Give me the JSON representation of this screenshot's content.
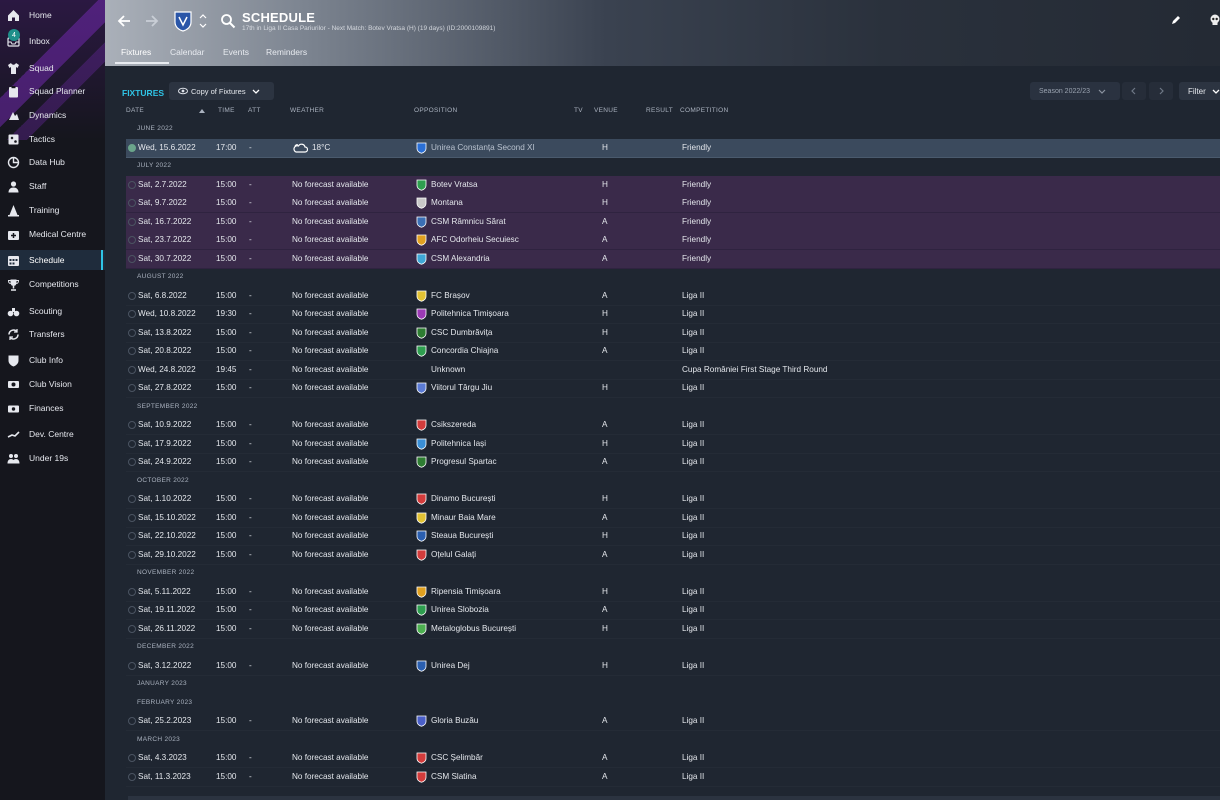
{
  "sidebar": {
    "items": [
      {
        "label": "Home",
        "icon": "home-icon"
      },
      {
        "label": "Inbox",
        "icon": "inbox-icon",
        "badge": "4"
      },
      {
        "label": "Squad",
        "icon": "shirt-icon"
      },
      {
        "label": "Squad Planner",
        "icon": "clipboard-icon"
      },
      {
        "label": "Dynamics",
        "icon": "dynamics-icon"
      },
      {
        "label": "Tactics",
        "icon": "tactics-board-icon"
      },
      {
        "label": "Data Hub",
        "icon": "data-hub-icon"
      },
      {
        "label": "Staff",
        "icon": "staff-icon"
      },
      {
        "label": "Training",
        "icon": "training-cone-icon"
      },
      {
        "label": "Medical Centre",
        "icon": "medical-icon"
      },
      {
        "label": "Schedule",
        "icon": "calendar-icon",
        "active": true
      },
      {
        "label": "Competitions",
        "icon": "trophy-icon"
      },
      {
        "label": "Scouting",
        "icon": "binoculars-icon"
      },
      {
        "label": "Transfers",
        "icon": "transfers-icon"
      },
      {
        "label": "Club Info",
        "icon": "shield-icon"
      },
      {
        "label": "Club Vision",
        "icon": "eye-icon"
      },
      {
        "label": "Finances",
        "icon": "finances-icon"
      },
      {
        "label": "Dev. Centre",
        "icon": "dev-centre-icon"
      },
      {
        "label": "Under 19s",
        "icon": "youth-team-icon"
      }
    ]
  },
  "header": {
    "title": "SCHEDULE",
    "subtitle": "17th in Liga II Casa Pariurilor - Next Match: Botev Vratsa (H) (19 days) (ID:2000109891)",
    "tabs": [
      "Fixtures",
      "Calendar",
      "Events",
      "Reminders"
    ]
  },
  "toolbar": {
    "heading": "FIXTURES",
    "view_label": "Copy of Fixtures",
    "season_label": "Season 2022/23",
    "filter_label": "Filter"
  },
  "columns": {
    "date": "DATE",
    "time": "TIME",
    "att": "ATT",
    "weather": "WEATHER",
    "opposition": "OPPOSITION",
    "tv": "TV",
    "venue": "VENUE",
    "result": "RESULT",
    "competition": "COMPETITION"
  },
  "colors": {
    "accent": "#2fc4e6",
    "friendly_row": "#3a2a4a",
    "selected_row": "#3b4a5d"
  },
  "schedule": [
    {
      "type": "month",
      "label": "JUNE 2022"
    },
    {
      "type": "fixture",
      "date": "Wed, 15.6.2022",
      "time": "17:00",
      "att": "-",
      "weather": "18°C",
      "weather_icon": "cloudy-icon",
      "opposition": "Unirea Constanța Second XI",
      "venue": "H",
      "competition": "Friendly",
      "selected": true,
      "friendly": false
    },
    {
      "type": "month",
      "label": "JULY 2022"
    },
    {
      "type": "fixture",
      "date": "Sat, 2.7.2022",
      "time": "15:00",
      "att": "-",
      "weather": "No forecast available",
      "opposition": "Botev Vratsa",
      "venue": "H",
      "competition": "Friendly",
      "friendly": true
    },
    {
      "type": "fixture",
      "date": "Sat, 9.7.2022",
      "time": "15:00",
      "att": "-",
      "weather": "No forecast available",
      "opposition": "Montana",
      "venue": "H",
      "competition": "Friendly",
      "friendly": true
    },
    {
      "type": "fixture",
      "date": "Sat, 16.7.2022",
      "time": "15:00",
      "att": "-",
      "weather": "No forecast available",
      "opposition": "CSM Râmnicu Sărat",
      "venue": "A",
      "competition": "Friendly",
      "friendly": true
    },
    {
      "type": "fixture",
      "date": "Sat, 23.7.2022",
      "time": "15:00",
      "att": "-",
      "weather": "No forecast available",
      "opposition": "AFC Odorheiu Secuiesc",
      "venue": "A",
      "competition": "Friendly",
      "friendly": true
    },
    {
      "type": "fixture",
      "date": "Sat, 30.7.2022",
      "time": "15:00",
      "att": "-",
      "weather": "No forecast available",
      "opposition": "CSM Alexandria",
      "venue": "A",
      "competition": "Friendly",
      "friendly": true
    },
    {
      "type": "month",
      "label": "AUGUST 2022"
    },
    {
      "type": "fixture",
      "date": "Sat, 6.8.2022",
      "time": "15:00",
      "att": "-",
      "weather": "No forecast available",
      "opposition": "FC Brașov",
      "venue": "A",
      "competition": "Liga II"
    },
    {
      "type": "fixture",
      "date": "Wed, 10.8.2022",
      "time": "19:30",
      "att": "-",
      "weather": "No forecast available",
      "opposition": "Politehnica Timișoara",
      "venue": "H",
      "competition": "Liga II"
    },
    {
      "type": "fixture",
      "date": "Sat, 13.8.2022",
      "time": "15:00",
      "att": "-",
      "weather": "No forecast available",
      "opposition": "CSC Dumbrăvița",
      "venue": "H",
      "competition": "Liga II"
    },
    {
      "type": "fixture",
      "date": "Sat, 20.8.2022",
      "time": "15:00",
      "att": "-",
      "weather": "No forecast available",
      "opposition": "Concordia Chiajna",
      "venue": "A",
      "competition": "Liga II"
    },
    {
      "type": "fixture",
      "date": "Wed, 24.8.2022",
      "time": "19:45",
      "att": "-",
      "weather": "No forecast available",
      "opposition": "Unknown",
      "venue": "",
      "competition": "Cupa României First Stage Third Round",
      "no_crest": true
    },
    {
      "type": "fixture",
      "date": "Sat, 27.8.2022",
      "time": "15:00",
      "att": "-",
      "weather": "No forecast available",
      "opposition": "Viitorul Târgu Jiu",
      "venue": "H",
      "competition": "Liga II"
    },
    {
      "type": "month",
      "label": "SEPTEMBER 2022"
    },
    {
      "type": "fixture",
      "date": "Sat, 10.9.2022",
      "time": "15:00",
      "att": "-",
      "weather": "No forecast available",
      "opposition": "Csikszereda",
      "venue": "A",
      "competition": "Liga II"
    },
    {
      "type": "fixture",
      "date": "Sat, 17.9.2022",
      "time": "15:00",
      "att": "-",
      "weather": "No forecast available",
      "opposition": "Politehnica Iași",
      "venue": "H",
      "competition": "Liga II"
    },
    {
      "type": "fixture",
      "date": "Sat, 24.9.2022",
      "time": "15:00",
      "att": "-",
      "weather": "No forecast available",
      "opposition": "Progresul Spartac",
      "venue": "A",
      "competition": "Liga II"
    },
    {
      "type": "month",
      "label": "OCTOBER 2022"
    },
    {
      "type": "fixture",
      "date": "Sat, 1.10.2022",
      "time": "15:00",
      "att": "-",
      "weather": "No forecast available",
      "opposition": "Dinamo București",
      "venue": "H",
      "competition": "Liga II"
    },
    {
      "type": "fixture",
      "date": "Sat, 15.10.2022",
      "time": "15:00",
      "att": "-",
      "weather": "No forecast available",
      "opposition": "Minaur Baia Mare",
      "venue": "A",
      "competition": "Liga II"
    },
    {
      "type": "fixture",
      "date": "Sat, 22.10.2022",
      "time": "15:00",
      "att": "-",
      "weather": "No forecast available",
      "opposition": "Steaua București",
      "venue": "H",
      "competition": "Liga II"
    },
    {
      "type": "fixture",
      "date": "Sat, 29.10.2022",
      "time": "15:00",
      "att": "-",
      "weather": "No forecast available",
      "opposition": "Oțelul Galați",
      "venue": "A",
      "competition": "Liga II"
    },
    {
      "type": "month",
      "label": "NOVEMBER 2022"
    },
    {
      "type": "fixture",
      "date": "Sat, 5.11.2022",
      "time": "15:00",
      "att": "-",
      "weather": "No forecast available",
      "opposition": "Ripensia Timișoara",
      "venue": "H",
      "competition": "Liga II"
    },
    {
      "type": "fixture",
      "date": "Sat, 19.11.2022",
      "time": "15:00",
      "att": "-",
      "weather": "No forecast available",
      "opposition": "Unirea Slobozia",
      "venue": "A",
      "competition": "Liga II"
    },
    {
      "type": "fixture",
      "date": "Sat, 26.11.2022",
      "time": "15:00",
      "att": "-",
      "weather": "No forecast available",
      "opposition": "Metaloglobus București",
      "venue": "H",
      "competition": "Liga II"
    },
    {
      "type": "month",
      "label": "DECEMBER 2022"
    },
    {
      "type": "fixture",
      "date": "Sat, 3.12.2022",
      "time": "15:00",
      "att": "-",
      "weather": "No forecast available",
      "opposition": "Unirea Dej",
      "venue": "H",
      "competition": "Liga II"
    },
    {
      "type": "month",
      "label": "JANUARY 2023"
    },
    {
      "type": "month",
      "label": "FEBRUARY 2023"
    },
    {
      "type": "fixture",
      "date": "Sat, 25.2.2023",
      "time": "15:00",
      "att": "-",
      "weather": "No forecast available",
      "opposition": "Gloria Buzău",
      "venue": "A",
      "competition": "Liga II"
    },
    {
      "type": "month",
      "label": "MARCH 2023"
    },
    {
      "type": "fixture",
      "date": "Sat, 4.3.2023",
      "time": "15:00",
      "att": "-",
      "weather": "No forecast available",
      "opposition": "CSC Șelimbăr",
      "venue": "A",
      "competition": "Liga II"
    },
    {
      "type": "fixture",
      "date": "Sat, 11.3.2023",
      "time": "15:00",
      "att": "-",
      "weather": "No forecast available",
      "opposition": "CSM Slatina",
      "venue": "A",
      "competition": "Liga II"
    }
  ]
}
